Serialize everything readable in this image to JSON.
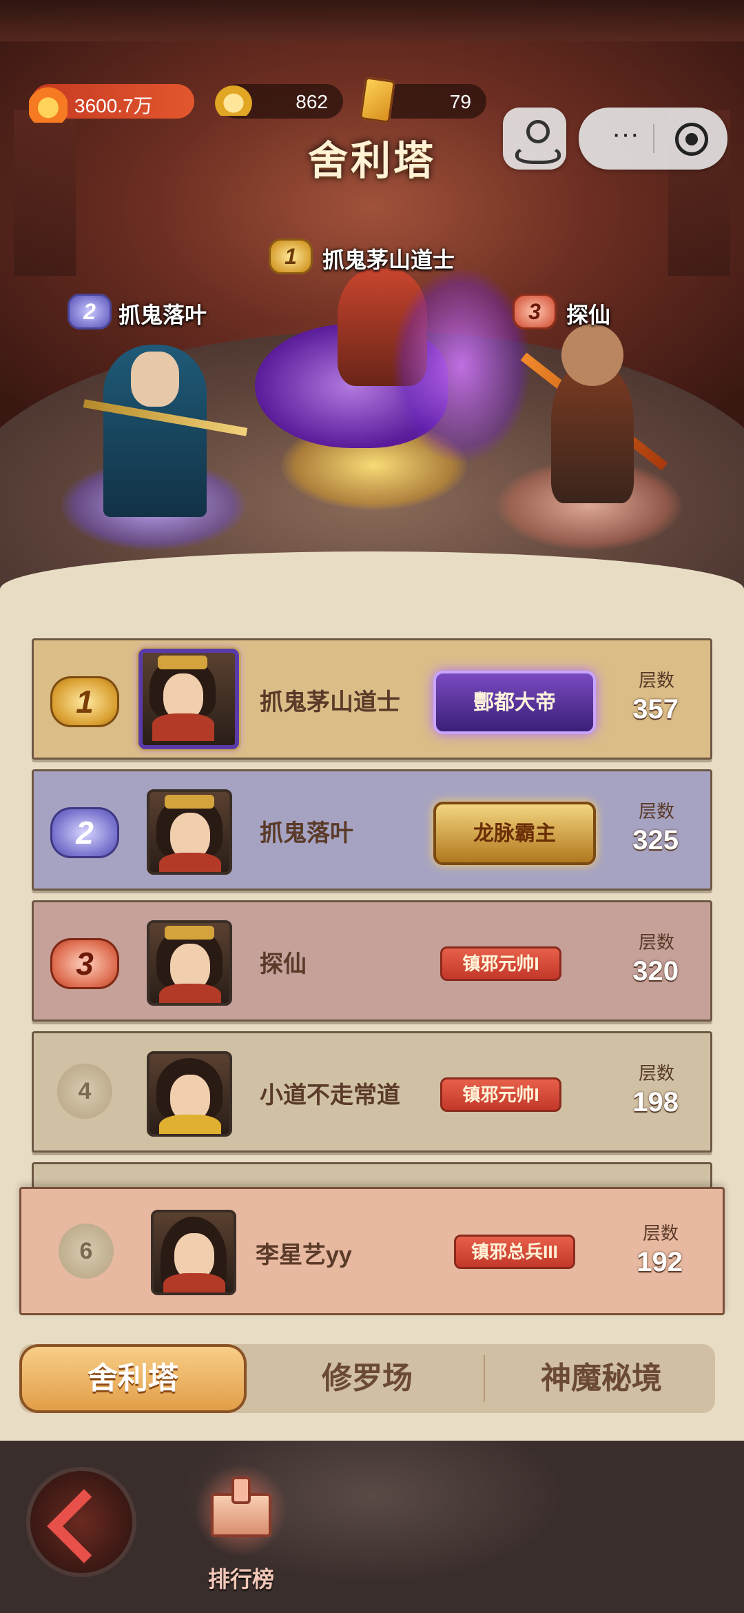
{
  "resources": {
    "power": "3600.7万",
    "gold": "862",
    "cards": "79"
  },
  "header": {
    "title": "舍利塔"
  },
  "podium": [
    {
      "rank": "1",
      "name": "抓鬼茅山道士"
    },
    {
      "rank": "2",
      "name": "抓鬼落叶"
    },
    {
      "rank": "3",
      "name": "探仙"
    }
  ],
  "ranking": {
    "floor_label": "层数",
    "rows": [
      {
        "rank": "1",
        "name": "抓鬼茅山道士",
        "title": "酆都大帝",
        "floors": "357"
      },
      {
        "rank": "2",
        "name": "抓鬼落叶",
        "title": "龙脉霸主",
        "floors": "325"
      },
      {
        "rank": "3",
        "name": "探仙",
        "title": "镇邪元帅I",
        "floors": "320"
      },
      {
        "rank": "4",
        "name": "小道不走常道",
        "title": "镇邪元帅I",
        "floors": "198"
      }
    ],
    "me": {
      "rank": "6",
      "name": "李星艺yy",
      "title": "镇邪总兵III",
      "floors": "192"
    }
  },
  "tabs": [
    "舍利塔",
    "修罗场",
    "神魔秘境"
  ],
  "bottom": {
    "rank_label": "排行榜"
  },
  "colors": {
    "gold_row": "#dbbd88",
    "purple_row": "#a6a3c2",
    "red_row": "#c5a19a",
    "plain_row": "#d0c1a4",
    "my_row": "#e7b9a0",
    "accent_tab": "#e19c46"
  }
}
